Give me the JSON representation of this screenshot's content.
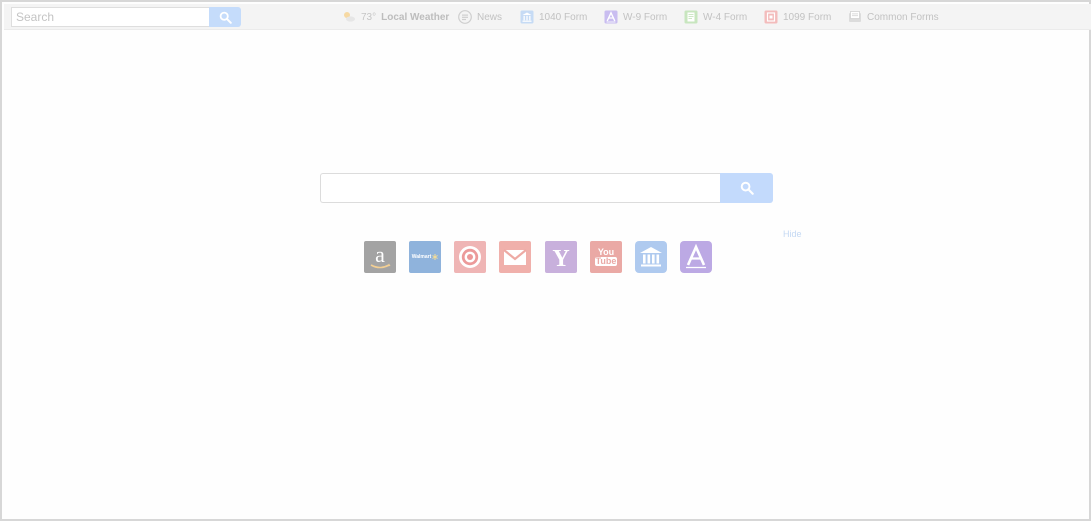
{
  "toolbar": {
    "search": {
      "placeholder": "Search"
    },
    "nav": [
      {
        "id": "weather",
        "temp": "73°",
        "label": "Local Weather",
        "icon": "weather-sun-cloud-icon"
      },
      {
        "id": "news",
        "label": "News",
        "icon": "news-icon"
      },
      {
        "id": "1040",
        "label": "1040 Form",
        "icon": "building-icon"
      },
      {
        "id": "w9",
        "label": "W-9 Form",
        "icon": "letter-a-icon"
      },
      {
        "id": "w4",
        "label": "W-4 Form",
        "icon": "document-icon"
      },
      {
        "id": "1099",
        "label": "1099 Form",
        "icon": "form-1099-icon"
      },
      {
        "id": "common",
        "label": "Common Forms",
        "icon": "forms-stack-icon"
      }
    ]
  },
  "main": {
    "search": {
      "placeholder": ""
    },
    "hide_label": "Hide",
    "shortcuts": [
      {
        "id": "amazon",
        "icon": "amazon-icon",
        "color": "#9a9a9a"
      },
      {
        "id": "walmart",
        "icon": "walmart-icon",
        "label": "Walmart",
        "color": "#8aaed6"
      },
      {
        "id": "target",
        "icon": "target-icon",
        "color": "#ec9a9a"
      },
      {
        "id": "gmail",
        "icon": "gmail-icon",
        "color": "#eeaaa4"
      },
      {
        "id": "yahoo",
        "icon": "yahoo-icon",
        "color": "#c4a9d8"
      },
      {
        "id": "youtube",
        "icon": "youtube-icon",
        "label_top": "You",
        "label_bottom": "Tube",
        "color": "#e9a6a2"
      },
      {
        "id": "bank",
        "icon": "bank-icon",
        "color": "#a9c6ee"
      },
      {
        "id": "fonts",
        "icon": "letter-a-icon",
        "color": "#b9a6e2"
      }
    ]
  },
  "colors": {
    "toolbar_bg": "#f4f4f4",
    "search_button": "#c5dcfb",
    "frame_border": "#d7d7d7"
  }
}
